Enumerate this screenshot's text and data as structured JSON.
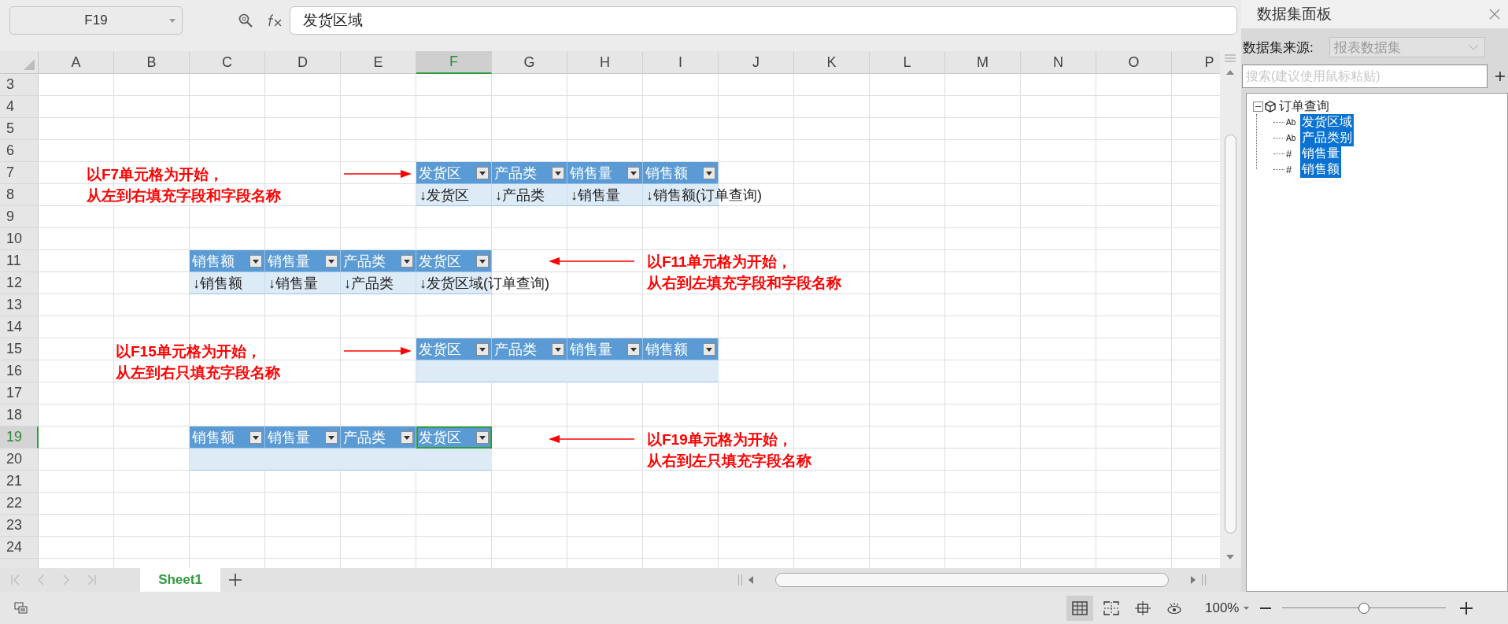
{
  "name_box": {
    "value": "F19"
  },
  "formula_bar": {
    "value": "发货区域"
  },
  "sheet": {
    "columns": [
      {
        "label": "A",
        "selected": false
      },
      {
        "label": "B",
        "selected": false
      },
      {
        "label": "C",
        "selected": false
      },
      {
        "label": "D",
        "selected": false
      },
      {
        "label": "E",
        "selected": false
      },
      {
        "label": "F",
        "selected": true
      },
      {
        "label": "G",
        "selected": false
      },
      {
        "label": "H",
        "selected": false
      },
      {
        "label": "I",
        "selected": false
      },
      {
        "label": "J",
        "selected": false
      },
      {
        "label": "K",
        "selected": false
      },
      {
        "label": "L",
        "selected": false
      },
      {
        "label": "M",
        "selected": false
      },
      {
        "label": "N",
        "selected": false
      },
      {
        "label": "O",
        "selected": false
      },
      {
        "label": "P",
        "selected": false
      }
    ],
    "rows": [
      {
        "label": "3",
        "selected": false
      },
      {
        "label": "4",
        "selected": false
      },
      {
        "label": "5",
        "selected": false
      },
      {
        "label": "6",
        "selected": false
      },
      {
        "label": "7",
        "selected": false,
        "cells": [
          null,
          null,
          null,
          null,
          null,
          {
            "kind": "header",
            "text": "发货区",
            "selected": false
          },
          {
            "kind": "header",
            "text": "产品类",
            "selected": false
          },
          {
            "kind": "header",
            "text": "销售量",
            "selected": false
          },
          {
            "kind": "header",
            "text": "销售额",
            "selected": false
          }
        ]
      },
      {
        "label": "8",
        "selected": false,
        "cells": [
          null,
          null,
          null,
          null,
          null,
          {
            "kind": "field",
            "text": "↓发货区",
            "selected": false
          },
          {
            "kind": "field",
            "text": "↓产品类",
            "selected": false
          },
          {
            "kind": "field",
            "text": "↓销售量",
            "selected": false
          },
          {
            "kind": "field",
            "text": "↓销售额(订单查询)",
            "selected": false
          }
        ]
      },
      {
        "label": "9",
        "selected": false
      },
      {
        "label": "10",
        "selected": false
      },
      {
        "label": "11",
        "selected": false,
        "cells": [
          null,
          null,
          {
            "kind": "header",
            "text": "销售额",
            "selected": false
          },
          {
            "kind": "header",
            "text": "销售量",
            "selected": false
          },
          {
            "kind": "header",
            "text": "产品类",
            "selected": false
          },
          {
            "kind": "header",
            "text": "发货区",
            "selected": false
          }
        ]
      },
      {
        "label": "12",
        "selected": false,
        "cells": [
          null,
          null,
          {
            "kind": "field",
            "text": "↓销售额",
            "selected": false
          },
          {
            "kind": "field",
            "text": "↓销售量",
            "selected": false
          },
          {
            "kind": "field",
            "text": "↓产品类",
            "selected": false
          },
          {
            "kind": "field",
            "text": "↓发货区域(订单查询)",
            "selected": false
          }
        ]
      },
      {
        "label": "13",
        "selected": false
      },
      {
        "label": "14",
        "selected": false
      },
      {
        "label": "15",
        "selected": false,
        "cells": [
          null,
          null,
          null,
          null,
          null,
          {
            "kind": "header",
            "text": "发货区",
            "selected": false
          },
          {
            "kind": "header",
            "text": "产品类",
            "selected": false
          },
          {
            "kind": "header",
            "text": "销售量",
            "selected": false
          },
          {
            "kind": "header",
            "text": "销售额",
            "selected": false
          }
        ]
      },
      {
        "label": "16",
        "selected": false,
        "cells": [
          null,
          null,
          null,
          null,
          null,
          {
            "kind": "blank",
            "selected": false
          },
          {
            "kind": "blank",
            "selected": false
          },
          {
            "kind": "blank",
            "selected": false
          },
          {
            "kind": "blank",
            "selected": false
          }
        ]
      },
      {
        "label": "17",
        "selected": false
      },
      {
        "label": "18",
        "selected": false
      },
      {
        "label": "19",
        "selected": true,
        "cells": [
          null,
          null,
          {
            "kind": "header",
            "text": "销售额",
            "selected": false
          },
          {
            "kind": "header",
            "text": "销售量",
            "selected": false
          },
          {
            "kind": "header",
            "text": "产品类",
            "selected": false
          },
          {
            "kind": "header",
            "text": "发货区",
            "selected": true
          }
        ]
      },
      {
        "label": "20",
        "selected": false,
        "cells": [
          null,
          null,
          {
            "kind": "blank",
            "selected": false
          },
          {
            "kind": "blank",
            "selected": false
          },
          {
            "kind": "blank",
            "selected": false
          },
          {
            "kind": "blank",
            "selected": false
          }
        ]
      },
      {
        "label": "21",
        "selected": false
      },
      {
        "label": "22",
        "selected": false
      },
      {
        "label": "23",
        "selected": false
      },
      {
        "label": "24",
        "selected": false
      }
    ],
    "annotations": [
      {
        "lines": [
          "以F7单元格为开始，",
          "从左到右填充字段和字段名称"
        ],
        "kind": "right"
      },
      {
        "lines": [
          "以F11单元格为开始，",
          "从右到左填充字段和字段名称"
        ],
        "kind": "left"
      },
      {
        "lines": [
          "以F15单元格为开始，",
          "从左到右只填充字段名称"
        ],
        "kind": "right"
      },
      {
        "lines": [
          "以F19单元格为开始，",
          "从右到左只填充字段名称"
        ],
        "kind": "left"
      }
    ]
  },
  "sheet_tabs": [
    {
      "label": "Sheet1",
      "selected": true
    }
  ],
  "panel": {
    "title": "数据集面板",
    "source_label": "数据集来源:",
    "source": {
      "value": "报表数据集",
      "disabled": true
    },
    "search": {
      "placeholder": "搜索(建议使用鼠标粘贴)"
    },
    "tree": [
      {
        "label": "订单查询",
        "expanded": true,
        "children": [
          {
            "label": "发货区域",
            "type_icon": "Ab",
            "selected": true
          },
          {
            "label": "产品类别",
            "type_icon": "Ab",
            "selected": true
          },
          {
            "label": "销售量",
            "type_icon": "#",
            "selected": true
          },
          {
            "label": "销售额",
            "type_icon": "#",
            "selected": true
          }
        ]
      }
    ]
  },
  "status_bar": {
    "views": [
      {
        "kind": "normal",
        "selected": true
      },
      {
        "kind": "page_break",
        "selected": false
      },
      {
        "kind": "page_layout",
        "selected": false
      },
      {
        "kind": "reading",
        "selected": false
      }
    ],
    "zoom": {
      "label": "100%",
      "level": 0.5
    }
  }
}
